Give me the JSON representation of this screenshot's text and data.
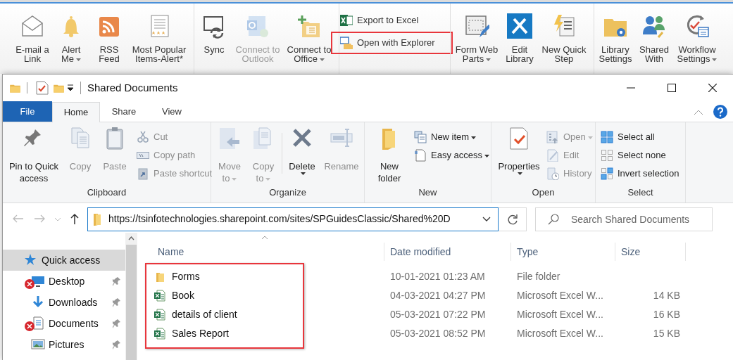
{
  "sharepoint_ribbon": {
    "groups": [
      {
        "kind": "large",
        "items": [
          {
            "label": "E-mail a\nLink",
            "dropdown": false,
            "disabled": false
          },
          {
            "label": "Alert\nMe",
            "dropdown": true,
            "disabled": false
          },
          {
            "label": "RSS\nFeed",
            "dropdown": false,
            "disabled": false
          },
          {
            "label": "Most Popular\nItems-Alert*",
            "dropdown": false,
            "disabled": false
          }
        ]
      },
      {
        "kind": "large",
        "items": [
          {
            "label": "Sync",
            "dropdown": false,
            "disabled": false
          },
          {
            "label": "Connect to\nOutlook",
            "dropdown": false,
            "disabled": true
          },
          {
            "label": "Connect to\nOffice",
            "dropdown": true,
            "disabled": false
          }
        ]
      },
      {
        "kind": "small",
        "items": [
          {
            "label": "Export to Excel",
            "highlighted": false
          },
          {
            "label": "Open with Explorer",
            "highlighted": true
          }
        ]
      },
      {
        "kind": "large",
        "items": [
          {
            "label": "Form Web\nParts",
            "dropdown": true,
            "disabled": false
          },
          {
            "label": "Edit\nLibrary",
            "dropdown": false,
            "disabled": false
          },
          {
            "label": "New Quick\nStep",
            "dropdown": false,
            "disabled": false
          }
        ]
      },
      {
        "kind": "large",
        "items": [
          {
            "label": "Library\nSettings",
            "dropdown": false,
            "disabled": false
          },
          {
            "label": "Shared\nWith",
            "dropdown": false,
            "disabled": false
          },
          {
            "label": "Workflow\nSettings",
            "dropdown": true,
            "disabled": false
          }
        ]
      }
    ]
  },
  "explorer": {
    "title": "Shared Documents",
    "tabs": [
      {
        "label": "File",
        "selected": false,
        "kind": "file"
      },
      {
        "label": "Home",
        "selected": true,
        "kind": "tab"
      },
      {
        "label": "Share",
        "selected": false,
        "kind": "tab"
      },
      {
        "label": "View",
        "selected": false,
        "kind": "tab"
      }
    ],
    "ribbon_groups": [
      {
        "label": "Clipboard",
        "large": [
          {
            "label": "Pin to Quick\naccess",
            "disabled": false,
            "dropdown": false
          },
          {
            "label": "Copy",
            "disabled": true,
            "dropdown": false
          },
          {
            "label": "Paste",
            "disabled": true,
            "dropdown": false
          }
        ],
        "small": [
          {
            "label": "Cut",
            "disabled": true,
            "dropdown": false
          },
          {
            "label": "Copy path",
            "disabled": true,
            "dropdown": false
          },
          {
            "label": "Paste shortcut",
            "disabled": true,
            "dropdown": false
          }
        ]
      },
      {
        "label": "Organize",
        "large": [
          {
            "label": "Move\nto",
            "disabled": true,
            "dropdown": true
          },
          {
            "label": "Copy\nto",
            "disabled": true,
            "dropdown": true
          },
          {
            "label": "Delete",
            "disabled": false,
            "dropdown": true
          },
          {
            "label": "Rename",
            "disabled": true,
            "dropdown": false
          }
        ]
      },
      {
        "label": "New",
        "large": [
          {
            "label": "New\nfolder",
            "disabled": false,
            "dropdown": false
          }
        ],
        "small": [
          {
            "label": "New item",
            "disabled": false,
            "dropdown": true
          },
          {
            "label": "Easy access",
            "disabled": false,
            "dropdown": true
          }
        ]
      },
      {
        "label": "Open",
        "large": [
          {
            "label": "Properties",
            "disabled": false,
            "dropdown": true
          }
        ],
        "small": [
          {
            "label": "Open",
            "disabled": true,
            "dropdown": true
          },
          {
            "label": "Edit",
            "disabled": true,
            "dropdown": false
          },
          {
            "label": "History",
            "disabled": true,
            "dropdown": false
          }
        ]
      },
      {
        "label": "Select",
        "small": [
          {
            "label": "Select all",
            "disabled": false,
            "dropdown": false
          },
          {
            "label": "Select none",
            "disabled": false,
            "dropdown": false
          },
          {
            "label": "Invert selection",
            "disabled": false,
            "dropdown": false
          }
        ]
      }
    ],
    "address": "https://tsinfotechnologies.sharepoint.com/sites/SPGuidesClassic/Shared%20D",
    "search": {
      "placeholder": "Search Shared Documents"
    },
    "nav_pane": [
      {
        "label": "Quick access",
        "selected": true,
        "pinned": false,
        "error": false
      },
      {
        "label": "Desktop",
        "selected": false,
        "pinned": true,
        "error": true
      },
      {
        "label": "Downloads",
        "selected": false,
        "pinned": true,
        "error": false
      },
      {
        "label": "Documents",
        "selected": false,
        "pinned": true,
        "error": true
      },
      {
        "label": "Pictures",
        "selected": false,
        "pinned": true,
        "error": false
      }
    ],
    "columns": [
      "Name",
      "Date modified",
      "Type",
      "Size"
    ],
    "names_highlighted": true,
    "rows": [
      {
        "kind": "folder",
        "name": "Forms",
        "date": "10-01-2021 01:23 AM",
        "type": "File folder"
      },
      {
        "kind": "excel",
        "name": "Book",
        "date": "04-03-2021 04:27 PM",
        "type": "Microsoft Excel W...",
        "size": "14 KB"
      },
      {
        "kind": "excel",
        "name": "details of client",
        "date": "05-03-2021 07:22 PM",
        "type": "Microsoft Excel W...",
        "size": "16 KB"
      },
      {
        "kind": "excel",
        "name": "Sales Report",
        "date": "05-03-2021 08:52 PM",
        "type": "Microsoft Excel W...",
        "size": "15 KB"
      }
    ]
  }
}
